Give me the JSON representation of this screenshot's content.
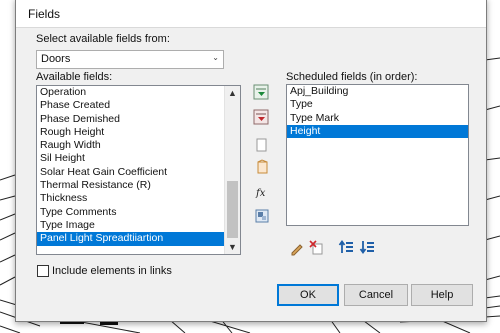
{
  "dialog": {
    "title": "Fields",
    "source_label": "Select available fields from:",
    "source_value": "Doors",
    "available_label": "Available fields:",
    "scheduled_label": "Scheduled fields (in  order):",
    "available_fields": [
      "Operation",
      "Phase Created",
      "Phase Demished",
      "Rough Height",
      "Raugh Width",
      "Sil Height",
      "Solar Heat Gain Coefficient",
      "Thermal Resistance (R)",
      "Thickness",
      "Type Comments",
      "Type Image",
      "Panel Light Spreadtiiartion"
    ],
    "available_selected_index": 11,
    "scheduled_fields": [
      "Apj_Building",
      "Type",
      "Type Mark",
      "Height"
    ],
    "scheduled_selected_index": 3,
    "include_links_label": "Include elements in links",
    "include_links_checked": false,
    "buttons": {
      "ok": "OK",
      "cancel": "Cancel",
      "help": "Help"
    },
    "icons": {
      "add": "add-parameter-icon",
      "remove": "remove-parameter-icon",
      "new_parameter": "new-parameter-icon",
      "formula": "formula-icon",
      "combine": "combine-parameters-icon",
      "edit": "edit-pencil-icon",
      "delete": "delete-parameter-icon",
      "move_up": "move-up-icon",
      "move_down": "move-down-icon"
    }
  },
  "colors": {
    "selection": "#0078d7",
    "dialog_bg": "#f0f0f0",
    "default_button_border": "#0078d7"
  }
}
